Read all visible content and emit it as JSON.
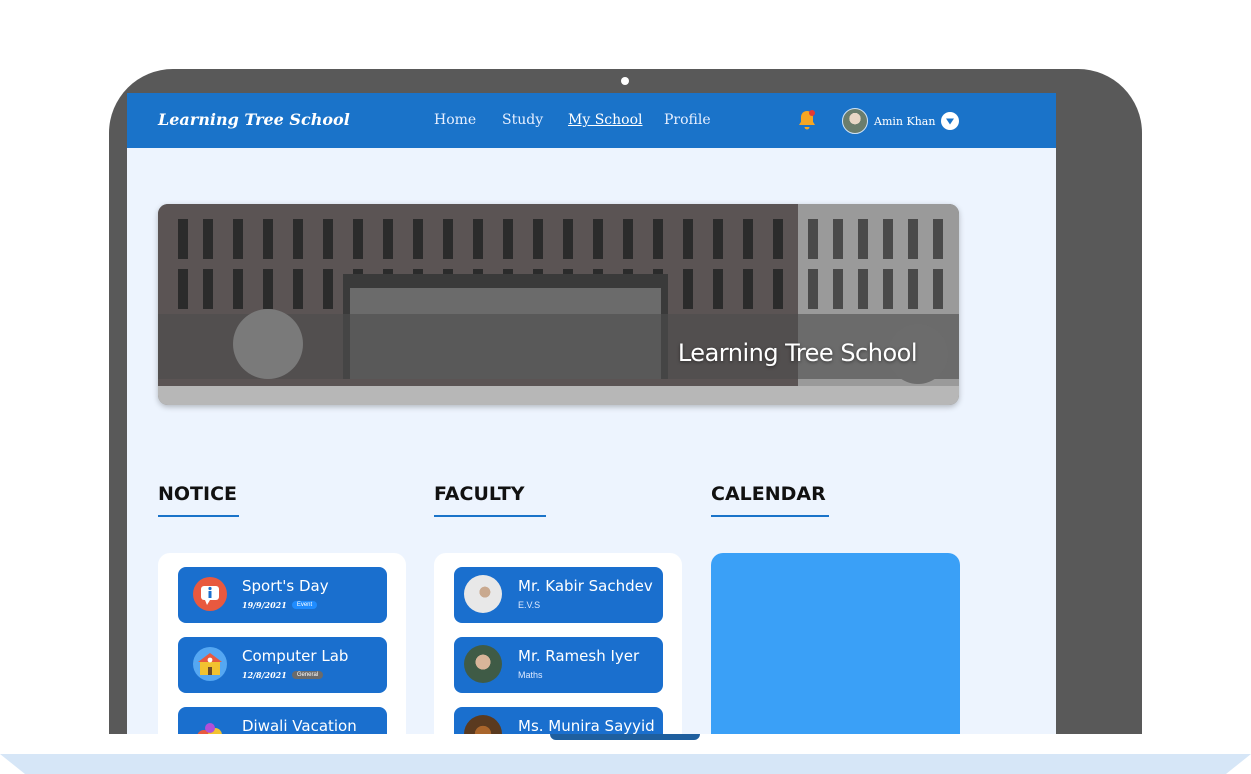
{
  "navbar": {
    "brand": "Learning Tree School",
    "links": [
      "Home",
      "Study",
      "My School",
      "Profile"
    ],
    "active_link": "My School",
    "user_name": "Amin Khan"
  },
  "hero": {
    "caption": "Learning Tree School"
  },
  "sections": {
    "notice": "NOTICE",
    "faculty": "FACULTY",
    "calendar": "CALENDAR"
  },
  "notices": [
    {
      "title": "Sport's Day",
      "date": "19/9/2021",
      "tag": "Event",
      "tag_color": "#1f8cff",
      "icon": "info-icon"
    },
    {
      "title": "Computer Lab",
      "date": "12/8/2021",
      "tag": "General",
      "tag_color": "#6b6b6b",
      "icon": "school-icon"
    },
    {
      "title": "Diwali Vacation",
      "icon": "celebration-icon"
    }
  ],
  "faculty": [
    {
      "name": "Mr. Kabir Sachdev",
      "subject": "E.V.S"
    },
    {
      "name": "Mr. Ramesh Iyer",
      "subject": "Maths"
    },
    {
      "name": "Ms. Munira Sayyid"
    }
  ],
  "colors": {
    "navbar": "#1a73c9",
    "card_blue": "#1a6fce",
    "calendar": "#3aa0f7",
    "page_bg": "#edf4fe"
  }
}
